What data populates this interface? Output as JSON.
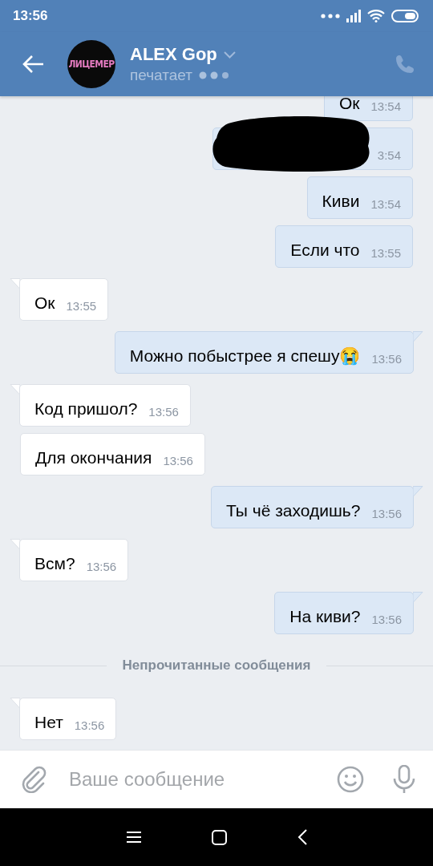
{
  "status_bar": {
    "time": "13:56"
  },
  "header": {
    "avatar_text": "ЛИЦЕМЕР",
    "name": "ALEX Gop",
    "status": "печатает"
  },
  "messages": [
    {
      "kind": "outgoing",
      "text": "Ок",
      "time": "13:54",
      "tail": false
    },
    {
      "kind": "redacted",
      "time": "3:54",
      "tail": false
    },
    {
      "kind": "outgoing",
      "text": "Киви",
      "time": "13:54",
      "tail": false
    },
    {
      "kind": "outgoing",
      "text": "Если что",
      "time": "13:55",
      "tail": false
    },
    {
      "kind": "incoming",
      "text": "Ок",
      "time": "13:55",
      "tail": true
    },
    {
      "kind": "outgoing",
      "text": "Можно побыстрее я спешу😭",
      "time": "13:56",
      "tail": true
    },
    {
      "kind": "incoming",
      "text": "Код пришол?",
      "time": "13:56",
      "tail": true
    },
    {
      "kind": "incoming",
      "text": "Для окончания",
      "time": "13:56",
      "tail": false
    },
    {
      "kind": "outgoing",
      "text": "Ты чё заходишь?",
      "time": "13:56",
      "tail": true
    },
    {
      "kind": "incoming",
      "text": "Всм?",
      "time": "13:56",
      "tail": true
    },
    {
      "kind": "outgoing",
      "text": "На киви?",
      "time": "13:56",
      "tail": true
    },
    {
      "kind": "divider",
      "text": "Непрочитанные сообщения"
    },
    {
      "kind": "incoming",
      "text": "Нет",
      "time": "13:56",
      "tail": true
    }
  ],
  "composer": {
    "placeholder": "Ваше сообщение"
  }
}
